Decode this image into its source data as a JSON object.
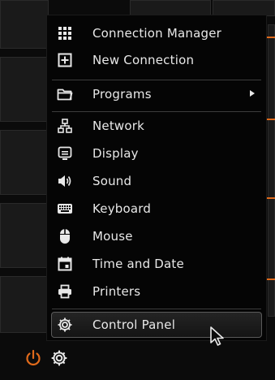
{
  "menu": {
    "items": [
      {
        "label": "Connection Manager",
        "icon": "grid-icon"
      },
      {
        "label": "New Connection",
        "icon": "plus-box-icon"
      },
      {
        "label": "Programs",
        "icon": "folder-icon",
        "submenu": true
      },
      {
        "label": "Network",
        "icon": "network-icon"
      },
      {
        "label": "Display",
        "icon": "display-icon"
      },
      {
        "label": "Sound",
        "icon": "speaker-icon"
      },
      {
        "label": "Keyboard",
        "icon": "keyboard-icon"
      },
      {
        "label": "Mouse",
        "icon": "mouse-icon"
      },
      {
        "label": "Time and Date",
        "icon": "calendar-icon"
      },
      {
        "label": "Printers",
        "icon": "printer-icon"
      },
      {
        "label": "Control Panel",
        "icon": "gear-icon",
        "selected": true
      }
    ]
  },
  "taskbar": {
    "power_icon": "power-icon",
    "settings_icon": "gear-icon"
  },
  "colors": {
    "accent": "#e06a1b",
    "menu_bg": "#050505",
    "text": "#e8e8e8"
  }
}
